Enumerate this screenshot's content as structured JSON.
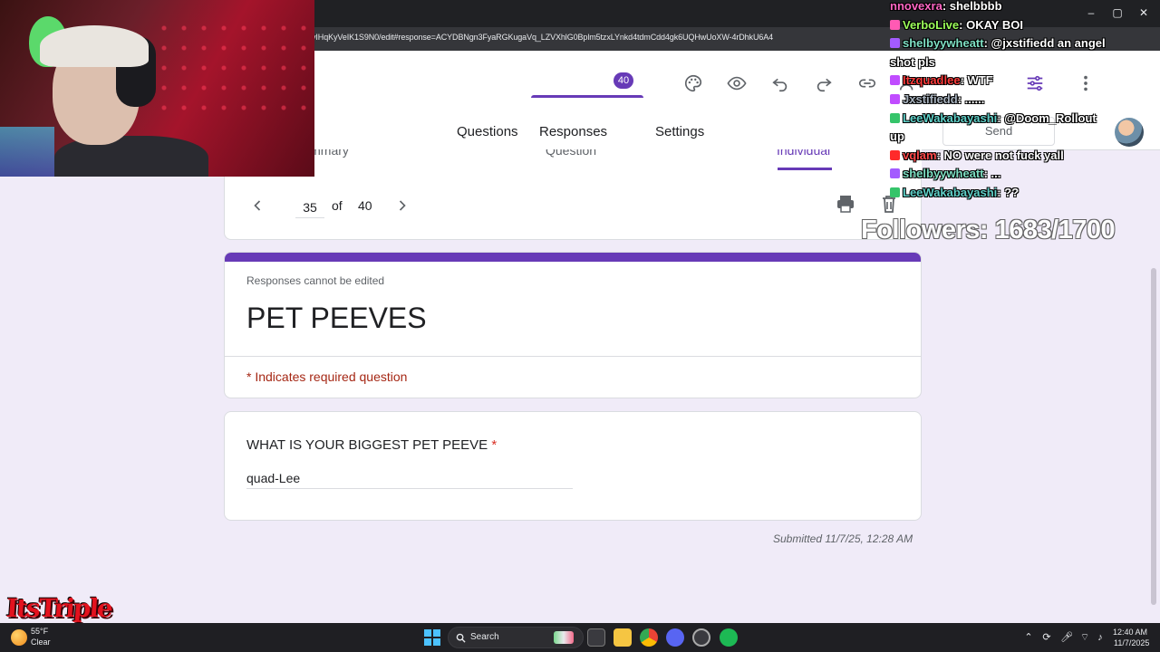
{
  "browser": {
    "url": "vIHqKyVeIK1S9N0/edit#response=ACYDBNgn3FyaRGKugaVq_LZVXhlG0Bplm5tzxLYnkd4tdmCdd4gk6UQHwUoXW-4rDhkU6A4"
  },
  "header": {
    "tabs": [
      {
        "label": "Questions"
      },
      {
        "label": "Responses"
      },
      {
        "label": "Settings"
      }
    ],
    "responses_count": "40",
    "send_label": "Send"
  },
  "subtabs": [
    {
      "label": "Summary"
    },
    {
      "label": "Question"
    },
    {
      "label": "Individual"
    }
  ],
  "pager": {
    "current": "35",
    "of_label": "of",
    "total": "40"
  },
  "form": {
    "cannot_edit": "Responses cannot be edited",
    "title": "PET PEEVES",
    "required_note": "* Indicates required question",
    "question": "WHAT IS YOUR BIGGEST PET PEEVE",
    "required_star": "*",
    "answer": "quad-Lee",
    "submitted": "Submitted 11/7/25, 12:28 AM"
  },
  "colors": {
    "accent": "#673ab7",
    "background": "#f0ebf8",
    "required": "#d93025"
  },
  "stream": {
    "chat": [
      {
        "user": "nnovexra",
        "message": "shelbbbb",
        "color": "#ff66c4",
        "badge": ""
      },
      {
        "user": "VerboLive",
        "message": "OKAY BOI",
        "color": "#9cff5a",
        "badge": "#ff5ab4"
      },
      {
        "user": "shelbyywheatt",
        "message": "@jxstifiedd an angel",
        "color": "#7ee0c3",
        "badge": "#a35bff"
      },
      {
        "user": "",
        "message": "shot pls",
        "color": "#ffffff",
        "badge": ""
      },
      {
        "user": "Itzquadlee",
        "message": "WTF",
        "color": "#ff3b3b",
        "badge": "#c04cff"
      },
      {
        "user": "Jxstifiedd",
        "message": "......",
        "color": "#a9b4c0",
        "badge": "#c04cff"
      },
      {
        "user": "LeeWakabayashi",
        "message": "@Doom_Rollout",
        "color": "#5fd0c8",
        "badge": "#35c46a"
      },
      {
        "user": "",
        "message": "up",
        "color": "#ffffff",
        "badge": ""
      },
      {
        "user": "vqlam",
        "message": "NO were not fuck yall",
        "color": "#ff4b4b",
        "badge": "#ff2a2a"
      },
      {
        "user": "shelbyywheatt",
        "message": "...",
        "color": "#7ee0c3",
        "badge": "#a35bff"
      },
      {
        "user": "LeeWakabayashi",
        "message": "??",
        "color": "#5fd0c8",
        "badge": "#35c46a"
      }
    ],
    "followers": "Followers: 1683/1700",
    "logo_text": "ItsTriple"
  },
  "taskbar": {
    "weather_temp": "55°F",
    "weather_cond": "Clear",
    "search_label": "Search",
    "time": "12:40 AM",
    "date": "11/7/2025"
  }
}
